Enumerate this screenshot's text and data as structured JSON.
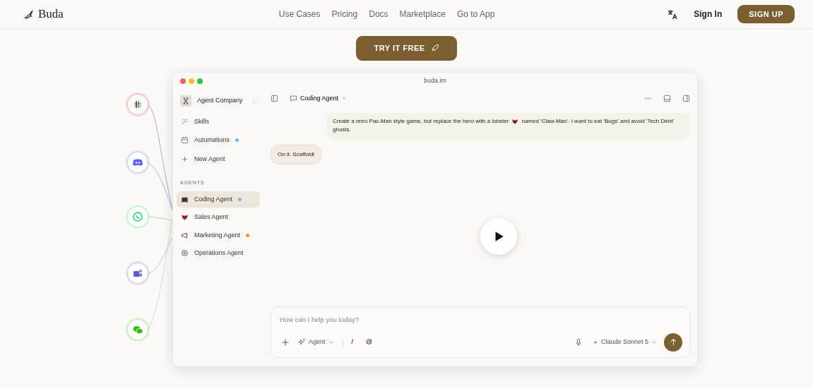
{
  "nav": {
    "logo": "Buda",
    "links": [
      "Use Cases",
      "Pricing",
      "Docs",
      "Marketplace",
      "Go to App"
    ],
    "sign_in": "Sign In",
    "sign_up": "SIGN UP"
  },
  "hero": {
    "button": "TRY IT FREE"
  },
  "integrations": [
    {
      "kind": "hash",
      "color": "#e01e5a"
    },
    {
      "kind": "game",
      "color": "#5865f2"
    },
    {
      "kind": "phone",
      "color": "#25d366"
    },
    {
      "kind": "team",
      "color": "#5b5fc7"
    },
    {
      "kind": "chat",
      "color": "#2dc100"
    }
  ],
  "window": {
    "title": "buda.im",
    "sidebar": {
      "workspace": "Agent Company",
      "items": [
        {
          "label": "Skills"
        },
        {
          "label": "Automations",
          "color": "#7fb2e5"
        },
        {
          "label": "New Agent"
        }
      ],
      "section": "AGENTS",
      "agents": [
        {
          "label": "Coding Agent",
          "selected": true,
          "color": "#7fb2e5"
        },
        {
          "label": "Sales Agent",
          "selected": false
        },
        {
          "label": "Marketing Agent",
          "selected": false,
          "color": "#f0932b"
        },
        {
          "label": "Operations Agent",
          "selected": false
        }
      ]
    },
    "chat": {
      "agent": "Coding Agent",
      "messages": [
        {
          "kind": "user",
          "text_before": "Create a retro Pac-Man style game, but replace the hero with a lobster",
          "text_after_lines": [
            "named 'Claw-Man'. I want to eat 'Bugs' and avoid 'Tech Debt'",
            "ghosts."
          ]
        },
        {
          "kind": "agent",
          "text_before": "On it. Scaffoldi"
        }
      ],
      "input": {
        "placeholder": "How can I help you today?",
        "mode": "Agent",
        "slash": "/",
        "at": "@",
        "model": "Claude Sonnet 5"
      }
    }
  }
}
